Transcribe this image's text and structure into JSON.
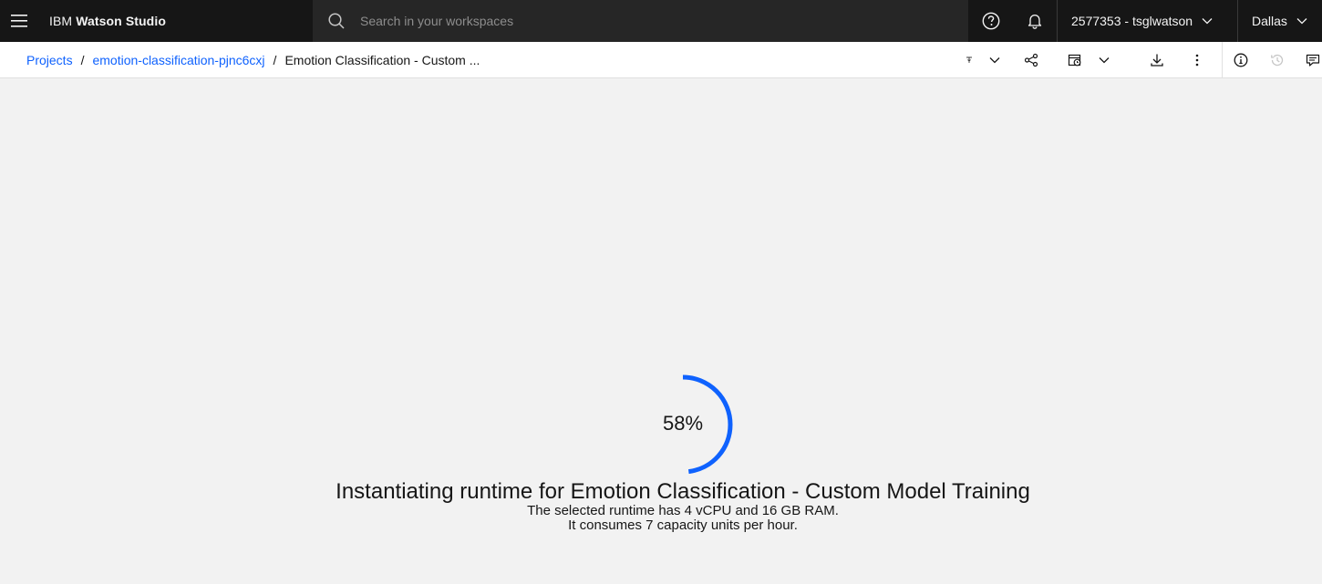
{
  "header": {
    "brand_prefix": "IBM",
    "brand_name": "Watson Studio",
    "search_placeholder": "Search in your workspaces",
    "account": "2577353 - tsglwatson",
    "region": "Dallas"
  },
  "breadcrumb": {
    "projects": "Projects",
    "sep": "/",
    "project": "emotion-classification-pjnc6cxj",
    "current": "Emotion Classification - Custom ..."
  },
  "toolbar": {
    "icons": [
      "kernel-status-icon",
      "share-icon",
      "schedule-job-icon",
      "download-icon",
      "overflow-menu-icon",
      "information-icon",
      "version-history-icon",
      "comments-icon"
    ]
  },
  "loading": {
    "percent_text": "58%",
    "progress": 0.58,
    "title": "Instantiating runtime for Emotion Classification - Custom Model Training",
    "line1": "The selected runtime has 4 vCPU and 16 GB RAM.",
    "line2": "It consumes 7 capacity units per hour."
  },
  "colors": {
    "header_bg": "#161616",
    "search_bg": "#262626",
    "link": "#0f62fe",
    "progress": "#0f62fe",
    "page_bg": "#f2f2f2"
  }
}
